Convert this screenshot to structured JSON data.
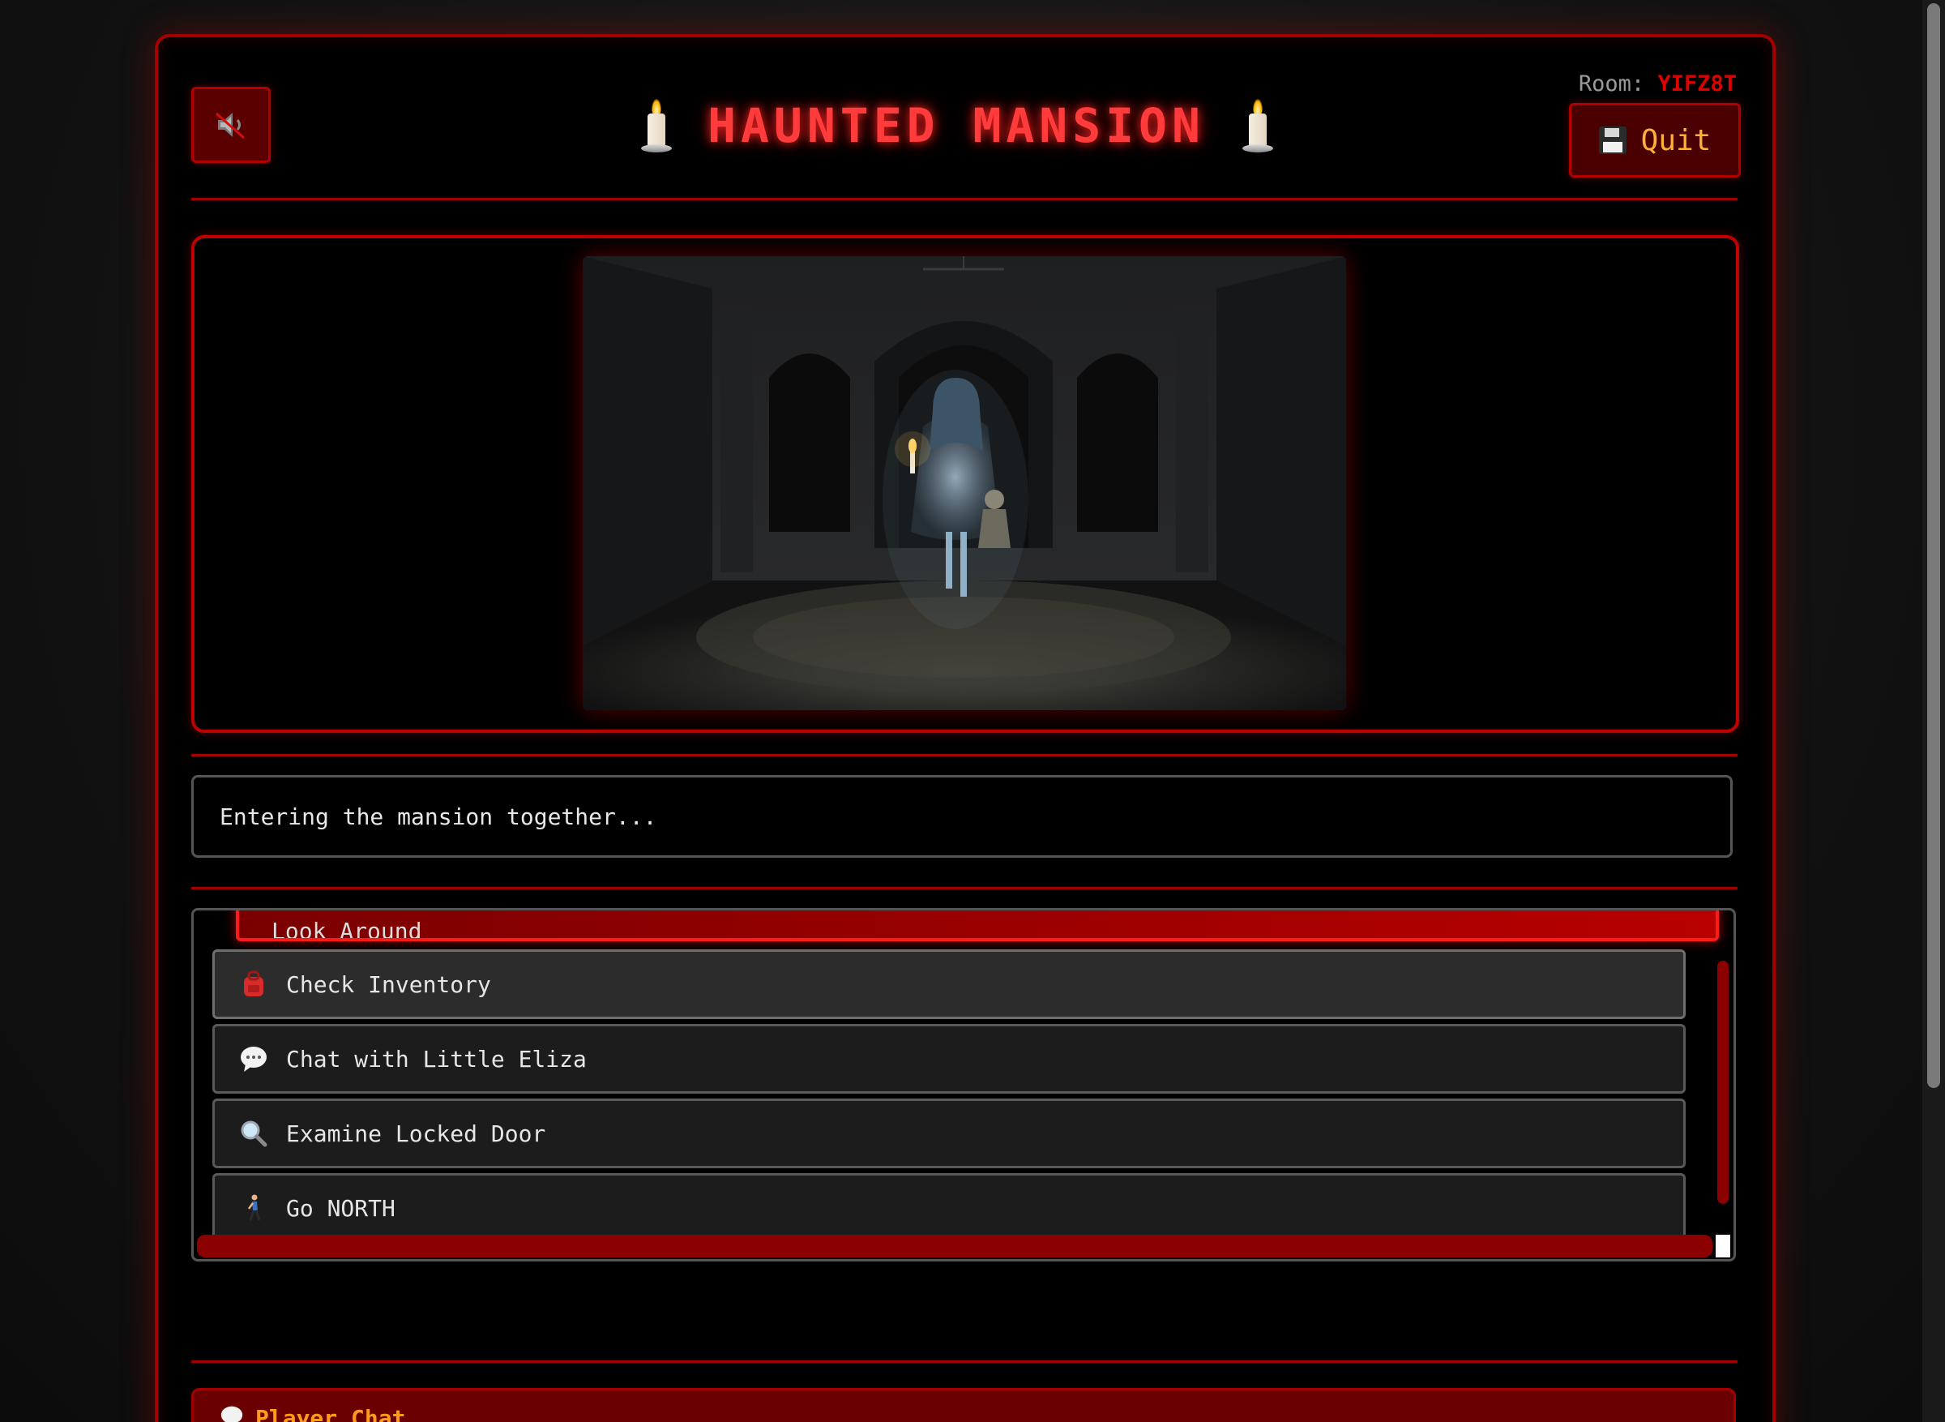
{
  "header": {
    "title": "HAUNTED MANSION",
    "room_prefix": "Room:",
    "room_code": "YIFZ8T",
    "quit_label": "Quit",
    "sound_icon": "muted-speaker-icon",
    "title_icon": "candle-icon"
  },
  "scene": {
    "image_subject": "ghost-girl-with-candle-and-doll-in-hallway"
  },
  "message": {
    "text": "Entering the mansion together..."
  },
  "actions": {
    "partial_label": "Look Around",
    "items": [
      {
        "label": "Check Inventory",
        "icon": "backpack-icon"
      },
      {
        "label": "Chat with Little Eliza",
        "icon": "speech-bubble-icon"
      },
      {
        "label": "Examine Locked Door",
        "icon": "magnifier-icon"
      },
      {
        "label": "Go NORTH",
        "icon": "walking-person-icon"
      }
    ]
  },
  "chat": {
    "title": "Player Chat"
  },
  "colors": {
    "accent_red": "#ff3b3b",
    "border_red": "#c00000",
    "quit_text": "#ffb03b",
    "chat_title": "#ff9a1a",
    "room_code": "#e00000"
  }
}
